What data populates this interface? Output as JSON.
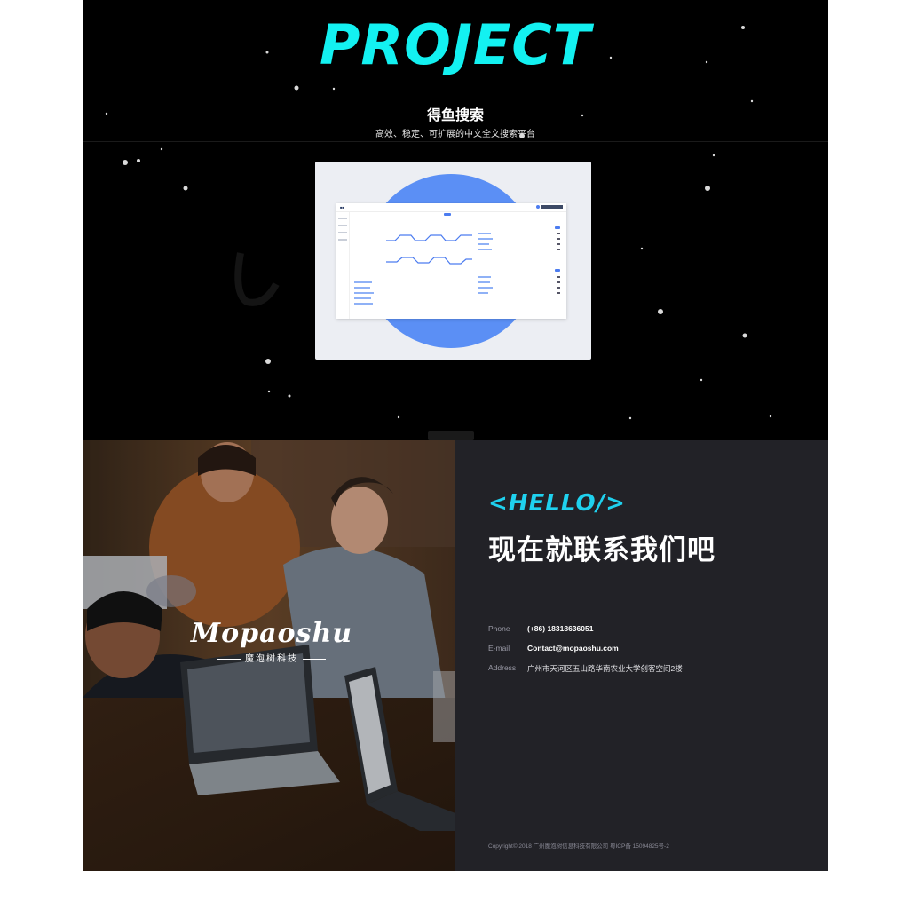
{
  "project": {
    "heading": "PROJECT",
    "name": "得鱼搜索",
    "description": "高效、稳定、可扩展的中文全文搜索平台"
  },
  "contact": {
    "hello": "<HELLO/>",
    "headline": "现在就联系我们吧",
    "phone_label": "Phone",
    "phone_value": "(+86) 18318636051",
    "email_label": "E-mail",
    "email_value": "Contact@mopaoshu.com",
    "address_label": "Address",
    "address_value": "广州市天河区五山路华南农业大学创客空间2楼",
    "copyright": "Copyright© 2018 广州魔泡树信息科技有限公司    粤ICP备    15094825号-2"
  },
  "brand": {
    "logo": "Mopaoshu",
    "logo_sub": "魔泡树科技"
  },
  "colors": {
    "project_bg": "#000000",
    "project_heading": "#13f1f1",
    "hello_accent": "#1fd1ee",
    "contact_bg": "#222227",
    "preview_circle": "#5b8ff5"
  }
}
